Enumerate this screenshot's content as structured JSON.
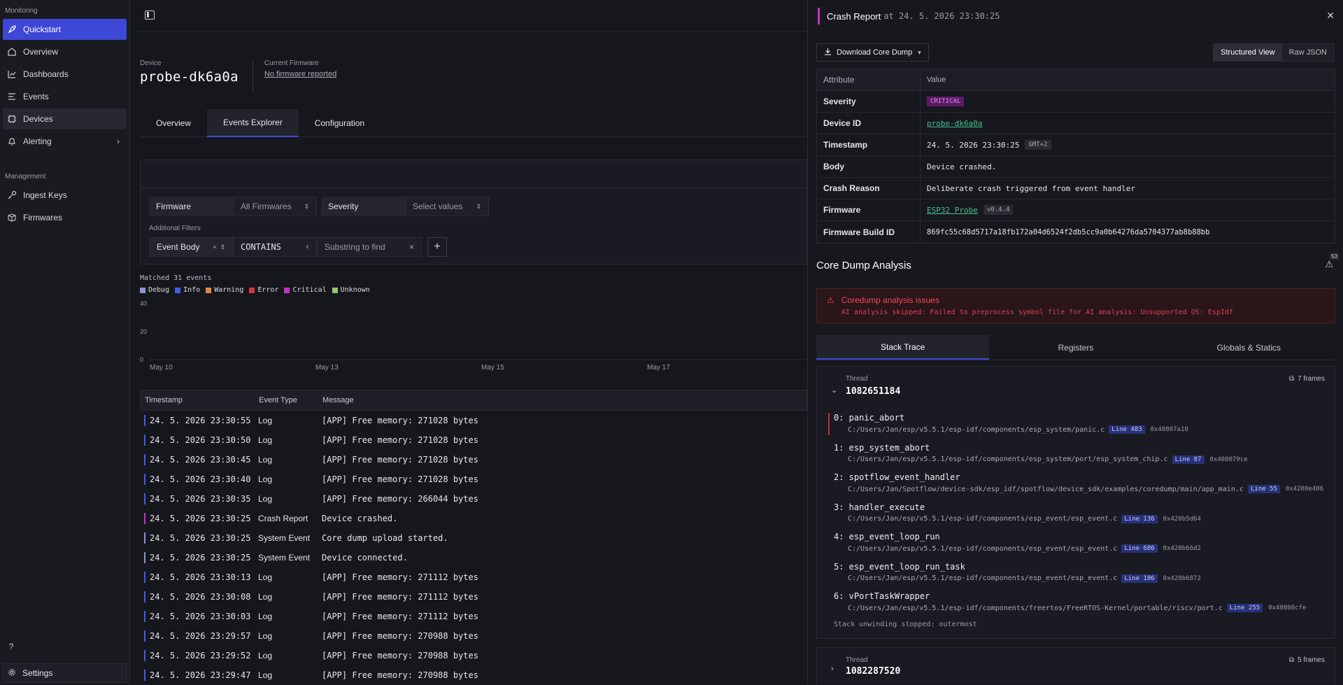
{
  "sidebar": {
    "monitoring_label": "Monitoring",
    "management_label": "Management",
    "monitoring_items": [
      {
        "label": "Quickstart",
        "icon": "rocket-icon"
      },
      {
        "label": "Overview",
        "icon": "home-icon"
      },
      {
        "label": "Dashboards",
        "icon": "chart-icon"
      },
      {
        "label": "Events",
        "icon": "list-icon"
      },
      {
        "label": "Devices",
        "icon": "chip-icon"
      },
      {
        "label": "Alerting",
        "icon": "bell-icon"
      }
    ],
    "management_items": [
      {
        "label": "Ingest Keys",
        "icon": "key-icon"
      },
      {
        "label": "Firmwares",
        "icon": "package-icon"
      }
    ],
    "help": "?",
    "settings_label": "Settings"
  },
  "device": {
    "label": "Device",
    "name": "probe-dk6a0a",
    "firmware_label": "Current Firmware",
    "firmware_value": "No firmware reported"
  },
  "tabs": [
    "Overview",
    "Events Explorer",
    "Configuration"
  ],
  "filters": {
    "firmware_label": "Firmware",
    "firmware_value": "All Firmwares",
    "severity_label": "Severity",
    "severity_placeholder": "Select values",
    "additional_label": "Additional Filters",
    "field": "Event Body",
    "operator": "CONTAINS",
    "substring_placeholder": "Substring to find"
  },
  "chart_data": {
    "type": "bar",
    "title": "Matched 31 events",
    "legend": [
      {
        "name": "Debug",
        "color": "#8a93d8"
      },
      {
        "name": "Info",
        "color": "#3d5ee8"
      },
      {
        "name": "Warning",
        "color": "#e08a3c"
      },
      {
        "name": "Error",
        "color": "#d8343f"
      },
      {
        "name": "Critical",
        "color": "#c033c6"
      },
      {
        "name": "Unknown",
        "color": "#9bc46a"
      }
    ],
    "y_ticks": [
      0,
      20,
      40
    ],
    "ylim": [
      0,
      40
    ],
    "x_ticks": [
      "May 10",
      "May 13",
      "May 15",
      "May 17"
    ],
    "grid": false
  },
  "table": {
    "headers": [
      "Timestamp",
      "Event Type",
      "Message"
    ],
    "rows": [
      {
        "ts": "24. 5. 2026 23:30:55",
        "type": "Log",
        "msg": "[APP] Free memory: 271028 bytes",
        "color": "#3d5ee8"
      },
      {
        "ts": "24. 5. 2026 23:30:50",
        "type": "Log",
        "msg": "[APP] Free memory: 271028 bytes",
        "color": "#3d5ee8"
      },
      {
        "ts": "24. 5. 2026 23:30:45",
        "type": "Log",
        "msg": "[APP] Free memory: 271028 bytes",
        "color": "#3d5ee8"
      },
      {
        "ts": "24. 5. 2026 23:30:40",
        "type": "Log",
        "msg": "[APP] Free memory: 271028 bytes",
        "color": "#3d5ee8"
      },
      {
        "ts": "24. 5. 2026 23:30:35",
        "type": "Log",
        "msg": "[APP] Free memory: 266044 bytes",
        "color": "#3d5ee8"
      },
      {
        "ts": "24. 5. 2026 23:30:25",
        "type": "Crash Report",
        "msg": "Device crashed.",
        "color": "#c033c6"
      },
      {
        "ts": "24. 5. 2026 23:30:25",
        "type": "System Event",
        "msg": "Core dump upload started.",
        "color": "#8a93d8"
      },
      {
        "ts": "24. 5. 2026 23:30:25",
        "type": "System Event",
        "msg": "Device connected.",
        "color": "#8a93d8"
      },
      {
        "ts": "24. 5. 2026 23:30:13",
        "type": "Log",
        "msg": "[APP] Free memory: 271112 bytes",
        "color": "#3d5ee8"
      },
      {
        "ts": "24. 5. 2026 23:30:08",
        "type": "Log",
        "msg": "[APP] Free memory: 271112 bytes",
        "color": "#3d5ee8"
      },
      {
        "ts": "24. 5. 2026 23:30:03",
        "type": "Log",
        "msg": "[APP] Free memory: 271112 bytes",
        "color": "#3d5ee8"
      },
      {
        "ts": "24. 5. 2026 23:29:57",
        "type": "Log",
        "msg": "[APP] Free memory: 270988 bytes",
        "color": "#3d5ee8"
      },
      {
        "ts": "24. 5. 2026 23:29:52",
        "type": "Log",
        "msg": "[APP] Free memory: 270988 bytes",
        "color": "#3d5ee8"
      },
      {
        "ts": "24. 5. 2026 23:29:47",
        "type": "Log",
        "msg": "[APP] Free memory: 270988 bytes",
        "color": "#3d5ee8"
      }
    ]
  },
  "crash": {
    "title": "Crash Report",
    "at_label": "at 24. 5. 2026 23:30:25",
    "download_label": "Download Core Dump",
    "view_structured": "Structured View",
    "view_raw": "Raw JSON",
    "attr_header": "Attribute",
    "value_header": "Value",
    "severity_key": "Severity",
    "severity_val": "CRITICAL",
    "device_id_key": "Device ID",
    "device_id_val": "probe-dk6a0a",
    "timestamp_key": "Timestamp",
    "timestamp_val": "24. 5. 2026 23:30:25",
    "timezone": "GMT+2",
    "body_key": "Body",
    "body_val": "Device crashed.",
    "reason_key": "Crash Reason",
    "reason_val": "Deliberate crash triggered from event handler",
    "firmware_key": "Firmware",
    "firmware_val": "ESP32 Probe",
    "firmware_ver": "v0.4.4",
    "build_key": "Firmware Build ID",
    "build_val": "869fc55c68d5717a18fb172a04d6524f2db5cc9a0b64276da5704377ab8b88bb"
  },
  "analysis": {
    "title": "Core Dump Analysis",
    "warning_count": "53",
    "error_title": "Coredump analysis issues",
    "error_detail": "AI analysis skipped: Failed to preprocess symbol file for AI analysis: Unsupported OS: EspIdf",
    "tabs": [
      "Stack Trace",
      "Registers",
      "Globals & Statics"
    ]
  },
  "thread1": {
    "label": "Thread",
    "id": "1082651184",
    "frames_count": "7 frames",
    "frames": [
      {
        "fn": "0: panic_abort",
        "path": "C:/Users/Jan/esp/v5.5.1/esp-idf/components/esp_system/panic.c",
        "line": "Line 483",
        "addr": "0x40807a10"
      },
      {
        "fn": "1: esp_system_abort",
        "path": "C:/Users/Jan/esp/v5.5.1/esp-idf/components/esp_system/port/esp_system_chip.c",
        "line": "Line 87",
        "addr": "0x408079ce"
      },
      {
        "fn": "2: spotflow_event_handler",
        "path": "C:/Users/Jan/Spotflow/device-sdk/esp_idf/spotflow/device_sdk/examples/coredump/main/app_main.c",
        "line": "Line 55",
        "addr": "0x4200e406"
      },
      {
        "fn": "3: handler_execute",
        "path": "C:/Users/Jan/esp/v5.5.1/esp-idf/components/esp_event/esp_event.c",
        "line": "Line 136",
        "addr": "0x420b5d64"
      },
      {
        "fn": "4: esp_event_loop_run",
        "path": "C:/Users/Jan/esp/v5.5.1/esp-idf/components/esp_event/esp_event.c",
        "line": "Line 686",
        "addr": "0x420b66d2"
      },
      {
        "fn": "5: esp_event_loop_run_task",
        "path": "C:/Users/Jan/esp/v5.5.1/esp-idf/components/esp_event/esp_event.c",
        "line": "Line 186",
        "addr": "0x420b6872"
      },
      {
        "fn": "6: vPortTaskWrapper",
        "path": "C:/Users/Jan/esp/v5.5.1/esp-idf/components/freertos/FreeRTOS-Kernel/portable/riscv/port.c",
        "line": "Line 255",
        "addr": "0x40808cfe"
      }
    ],
    "stop_note": "Stack unwinding stopped: outermost"
  },
  "thread2": {
    "label": "Thread",
    "id": "1082287520",
    "frames_count": "5 frames"
  }
}
